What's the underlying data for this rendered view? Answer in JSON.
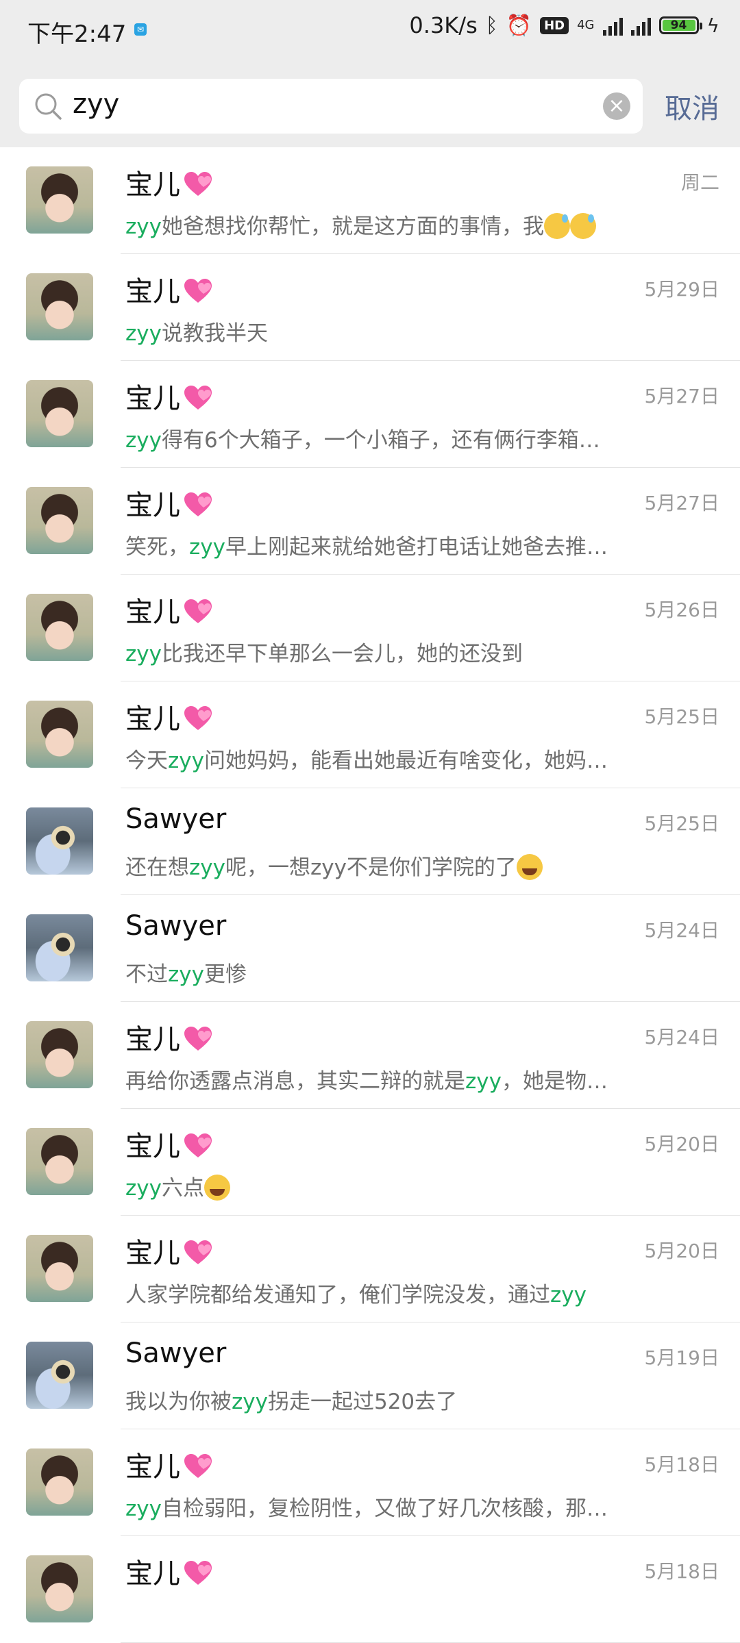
{
  "status_bar": {
    "time": "下午2:47",
    "net_speed": "0.3K/s",
    "hd_label": "HD",
    "network": "4G",
    "battery": "94",
    "accent_battery": "#58c640"
  },
  "search": {
    "query": "zyy",
    "cancel_label": "取消"
  },
  "colors": {
    "highlight": "#1aad5e",
    "cancel": "#576b95"
  },
  "results": [
    {
      "name": "宝儿",
      "avatar": "baby",
      "date": "周二",
      "before": "",
      "keyword": "zyy",
      "after": "她爸想找你帮忙，就是这方面的事情，我",
      "emoji": [
        "sweat",
        "sweat"
      ]
    },
    {
      "name": "宝儿",
      "avatar": "baby",
      "date": "5月29日",
      "before": "",
      "keyword": "zyy",
      "after": "说教我半天",
      "emoji": []
    },
    {
      "name": "宝儿",
      "avatar": "baby",
      "date": "5月27日",
      "before": "",
      "keyword": "zyy",
      "after": "得有6个大箱子，一个小箱子，还有俩行李箱…",
      "emoji": []
    },
    {
      "name": "宝儿",
      "avatar": "baby",
      "date": "5月27日",
      "before": "笑死，",
      "keyword": "zyy",
      "after": "早上刚起来就给她爸打电话让她爸去推…",
      "emoji": []
    },
    {
      "name": "宝儿",
      "avatar": "baby",
      "date": "5月26日",
      "before": "",
      "keyword": "zyy",
      "after": "比我还早下单那么一会儿，她的还没到",
      "emoji": []
    },
    {
      "name": "宝儿",
      "avatar": "baby",
      "date": "5月25日",
      "before": "今天",
      "keyword": "zyy",
      "after": "问她妈妈，能看出她最近有啥变化，她妈…",
      "emoji": []
    },
    {
      "name": "Sawyer",
      "avatar": "sawyer",
      "date": "5月25日",
      "before": "还在想",
      "keyword": "zyy",
      "after": "呢，一想zyy不是你们学院的了",
      "emoji": [
        "laugh"
      ]
    },
    {
      "name": "Sawyer",
      "avatar": "sawyer",
      "date": "5月24日",
      "before": "不过",
      "keyword": "zyy",
      "after": "更惨",
      "emoji": []
    },
    {
      "name": "宝儿",
      "avatar": "baby",
      "date": "5月24日",
      "before": "再给你透露点消息，其实二辩的就是",
      "keyword": "zyy",
      "after": "，她是物…",
      "emoji": []
    },
    {
      "name": "宝儿",
      "avatar": "baby",
      "date": "5月20日",
      "before": "",
      "keyword": "zyy",
      "after": "六点",
      "emoji": [
        "laugh"
      ]
    },
    {
      "name": "宝儿",
      "avatar": "baby",
      "date": "5月20日",
      "before": "人家学院都给发通知了，俺们学院没发，通过",
      "keyword": "zyy",
      "after": "",
      "emoji": []
    },
    {
      "name": "Sawyer",
      "avatar": "sawyer",
      "date": "5月19日",
      "before": "我以为你被",
      "keyword": "zyy",
      "after": "拐走一起过520去了",
      "emoji": []
    },
    {
      "name": "宝儿",
      "avatar": "baby",
      "date": "5月18日",
      "before": "",
      "keyword": "zyy",
      "after": "自检弱阳，复检阴性，又做了好几次核酸，那…",
      "emoji": []
    },
    {
      "name": "宝儿",
      "avatar": "baby",
      "date": "5月18日",
      "before": "",
      "keyword": "",
      "after": "",
      "emoji": []
    }
  ]
}
